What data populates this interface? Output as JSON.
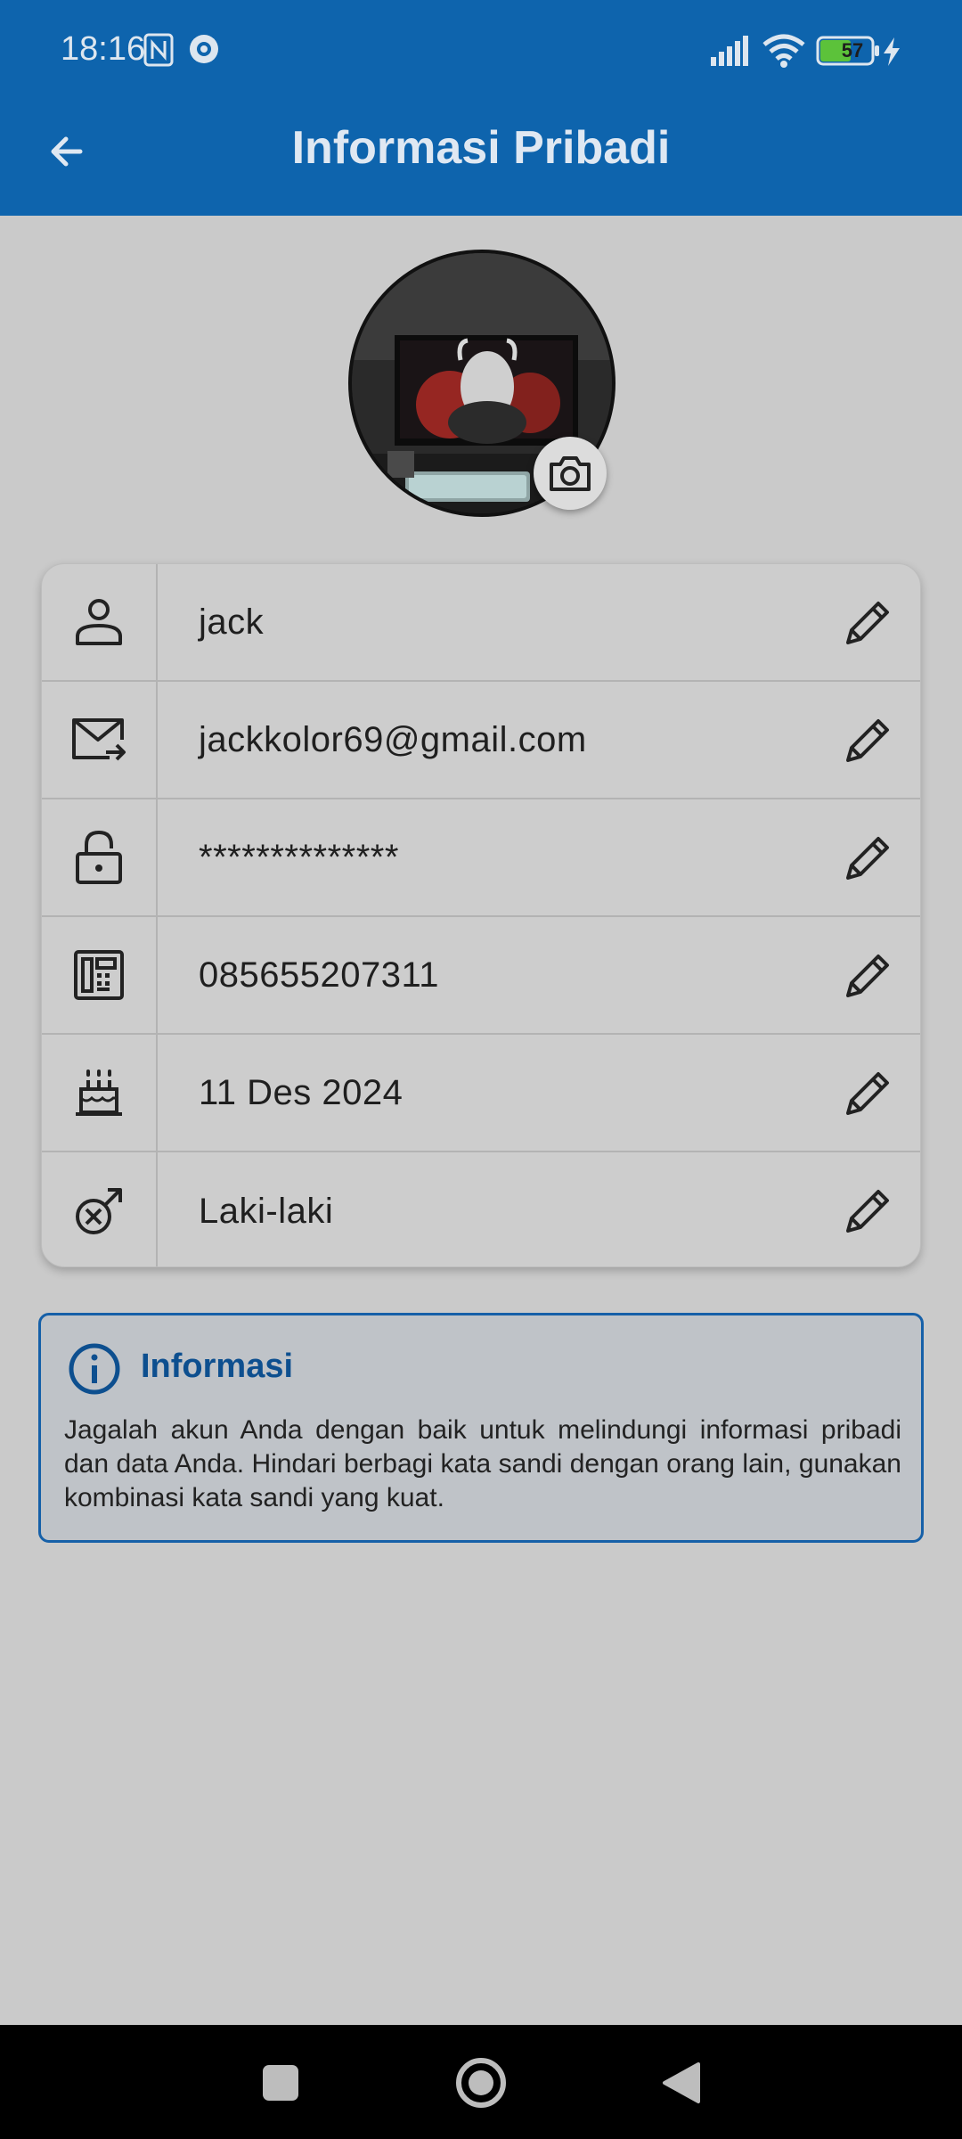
{
  "status_bar": {
    "time": "18:16",
    "battery_level": "57"
  },
  "app_bar": {
    "title": "Informasi Pribadi"
  },
  "profile": {
    "fields": [
      {
        "icon": "person-icon",
        "value": "jack"
      },
      {
        "icon": "mail-forward-icon",
        "value": "jackkolor69@gmail.com"
      },
      {
        "icon": "lock-icon",
        "value": "**************"
      },
      {
        "icon": "fax-phone-icon",
        "value": "085655207311"
      },
      {
        "icon": "birthday-cake-icon",
        "value": "11 Des 2024"
      },
      {
        "icon": "gender-male-icon",
        "value": "Laki-laki"
      }
    ]
  },
  "notice": {
    "title": "Informasi",
    "text": "Jagalah akun Anda dengan baik untuk melindungi informasi pribadi dan data Anda. Hindari berbagi kata sandi dengan orang lain, gunakan kombinasi kata sandi yang kuat."
  },
  "colors": {
    "brand": "#0e64ad",
    "background": "#cacaca",
    "notice_border": "#1660a8"
  }
}
